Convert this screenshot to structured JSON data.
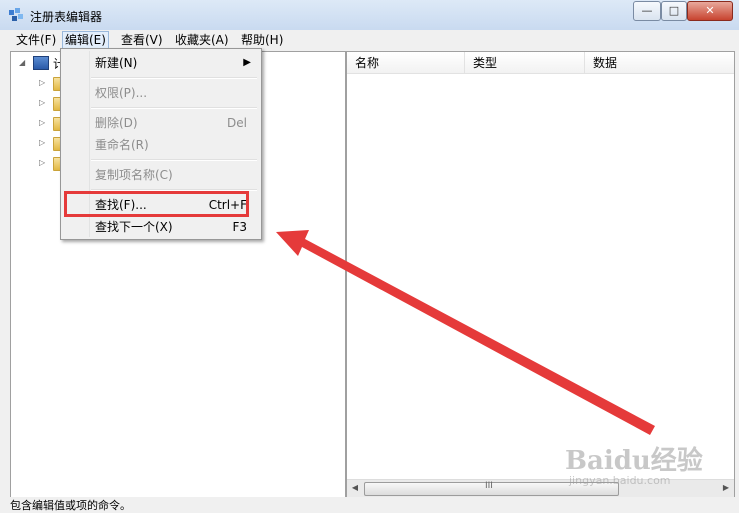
{
  "window": {
    "title": "注册表编辑器",
    "minimize": "—",
    "maximize": "□",
    "close": "✕"
  },
  "menubar": [
    {
      "label": "文件(F)"
    },
    {
      "label": "编辑(E)"
    },
    {
      "label": "查看(V)"
    },
    {
      "label": "收藏夹(A)"
    },
    {
      "label": "帮助(H)"
    }
  ],
  "tree": {
    "root_label": "计"
  },
  "list": {
    "columns": [
      "名称",
      "类型",
      "数据"
    ],
    "scrollbar_grip": "III"
  },
  "edit_menu": {
    "new": {
      "label": "新建(N)"
    },
    "permissions": {
      "label": "权限(P)..."
    },
    "delete": {
      "label": "删除(D)",
      "shortcut": "Del"
    },
    "rename": {
      "label": "重命名(R)"
    },
    "copy_key_name": {
      "label": "复制项名称(C)"
    },
    "find": {
      "label": "查找(F)...",
      "shortcut": "Ctrl+F"
    },
    "find_next": {
      "label": "查找下一个(X)",
      "shortcut": "F3"
    }
  },
  "statusbar": {
    "text": "包含编辑值或项的命令。"
  },
  "watermark": {
    "main": "Baidu经验",
    "sub": "jingyan.baidu.com"
  },
  "colors": {
    "annotation": "#e53a3a"
  }
}
